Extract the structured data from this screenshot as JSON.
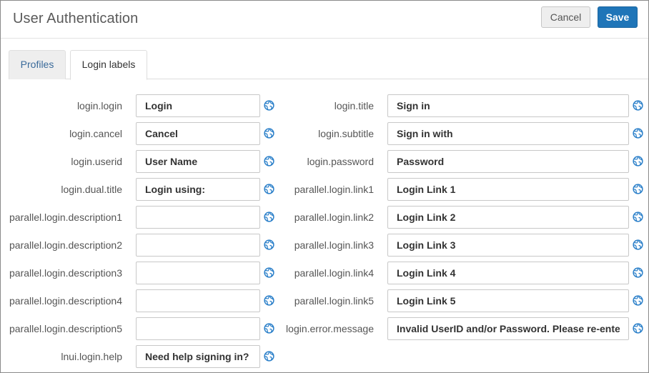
{
  "header": {
    "title": "User Authentication",
    "cancel_label": "Cancel",
    "save_label": "Save"
  },
  "tabs": [
    {
      "label": "Profiles",
      "active": false
    },
    {
      "label": "Login labels",
      "active": true
    }
  ],
  "left_column": [
    {
      "key": "login.login",
      "value": "Login"
    },
    {
      "key": "login.cancel",
      "value": "Cancel"
    },
    {
      "key": "login.userid",
      "value": "User Name"
    },
    {
      "key": "login.dual.title",
      "value": "Login using:"
    },
    {
      "key": "parallel.login.description1",
      "value": ""
    },
    {
      "key": "parallel.login.description2",
      "value": ""
    },
    {
      "key": "parallel.login.description3",
      "value": ""
    },
    {
      "key": "parallel.login.description4",
      "value": ""
    },
    {
      "key": "parallel.login.description5",
      "value": ""
    },
    {
      "key": "lnui.login.help",
      "value": "Need help signing in?"
    }
  ],
  "right_column": [
    {
      "key": "login.title",
      "value": "Sign in"
    },
    {
      "key": "login.subtitle",
      "value": "Sign in with"
    },
    {
      "key": "login.password",
      "value": "Password"
    },
    {
      "key": "parallel.login.link1",
      "value": "Login Link 1"
    },
    {
      "key": "parallel.login.link2",
      "value": "Login Link 2"
    },
    {
      "key": "parallel.login.link3",
      "value": "Login Link 3"
    },
    {
      "key": "parallel.login.link4",
      "value": "Login Link 4"
    },
    {
      "key": "parallel.login.link5",
      "value": "Login Link 5"
    },
    {
      "key": "login.error.message",
      "value": "Invalid UserID and/or Password. Please re-enter"
    }
  ],
  "icons": {
    "translate": "globe-icon"
  },
  "colors": {
    "primary": "#1f75b8",
    "tab_link": "#3a6a9a",
    "globe": "#2a7fc9"
  }
}
